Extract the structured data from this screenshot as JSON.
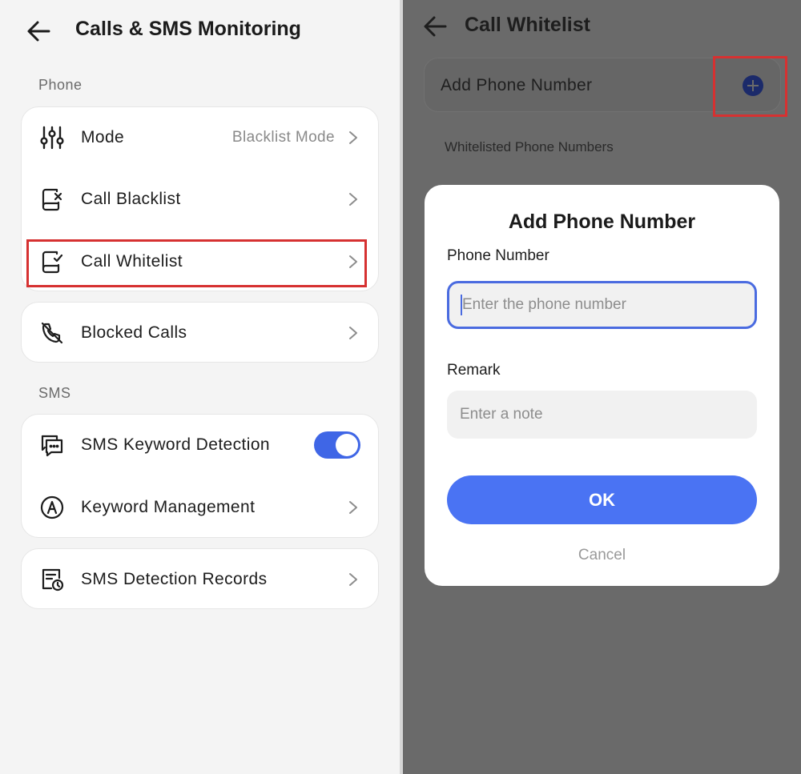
{
  "left": {
    "title": "Calls & SMS Monitoring",
    "sections": {
      "phone": "Phone",
      "sms": "SMS"
    },
    "phone_items": [
      {
        "label": "Mode",
        "value": "Blacklist Mode",
        "icon": "sliders-icon"
      },
      {
        "label": "Call Blacklist",
        "icon": "call-blacklist-icon"
      },
      {
        "label": "Call Whitelist",
        "icon": "call-whitelist-icon"
      }
    ],
    "blocked_calls": {
      "label": "Blocked Calls",
      "icon": "blocked-call-icon"
    },
    "sms_items": [
      {
        "label": "SMS Keyword Detection",
        "icon": "sms-chat-icon",
        "toggle_on": true
      },
      {
        "label": "Keyword Management",
        "icon": "keyword-a-icon"
      }
    ],
    "sms_records": {
      "label": "SMS Detection Records",
      "icon": "sms-records-icon"
    }
  },
  "right": {
    "title": "Call Whitelist",
    "add_label": "Add Phone Number",
    "list_heading": "Whitelisted Phone Numbers",
    "dialog": {
      "title": "Add Phone Number",
      "phone_label": "Phone Number",
      "phone_placeholder": "Enter the phone number",
      "phone_value": "",
      "remark_label": "Remark",
      "remark_placeholder": "Enter a note",
      "remark_value": "",
      "ok_label": "OK",
      "cancel_label": "Cancel"
    }
  },
  "colors": {
    "accent": "#4a73f3",
    "highlight": "#d63131",
    "overlay": "#6a6a6a"
  }
}
